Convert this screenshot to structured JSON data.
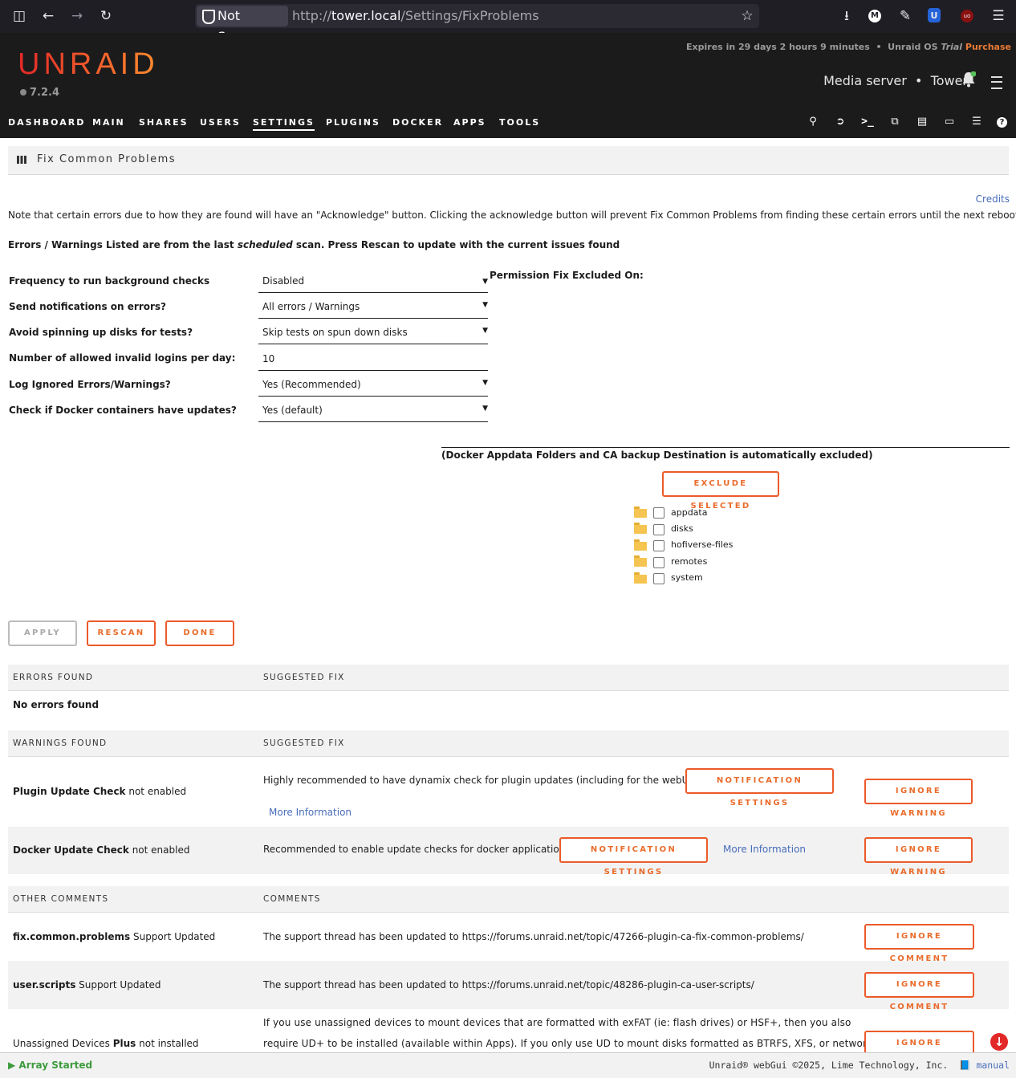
{
  "browser": {
    "not_secure": "Not Secure",
    "url_prefix": "http://",
    "url_host": "tower.local",
    "url_path": "/Settings/FixProblems"
  },
  "header": {
    "logo": "UNRAID",
    "version": "7.2.4",
    "trial_text": "Expires in 29 days 2 hours 9 minutes",
    "os_label": "Unraid OS",
    "os_trial": "Trial",
    "purchase": "Purchase",
    "server_desc": "Media server",
    "server_name": "Tower",
    "accent": "#f15a2c"
  },
  "nav": [
    "DASHBOARD",
    "MAIN",
    "SHARES",
    "USERS",
    "SETTINGS",
    "PLUGINS",
    "DOCKER",
    "APPS",
    "TOOLS"
  ],
  "page": {
    "title": "Fix Common Problems",
    "credits": "Credits",
    "note": "Note that certain errors due to how they are found will have an \"Acknowledge\" button. Clicking the acknowledge button will prevent Fix Common Problems from finding these certain errors until the next reboot",
    "scan_note_a": "Errors / Warnings Listed are from the last ",
    "scan_note_b": "scheduled",
    "scan_note_c": " scan. Press Rescan to update with the current issues found"
  },
  "settings": [
    {
      "label": "Frequency to run background checks",
      "value": "Disabled"
    },
    {
      "label": "Send notifications on errors?",
      "value": "All errors / Warnings"
    },
    {
      "label": "Avoid spinning up disks for tests?",
      "value": "Skip tests on spun down disks"
    },
    {
      "label": "Number of allowed invalid logins per day:",
      "value": "10"
    },
    {
      "label": "Log Ignored Errors/Warnings?",
      "value": "Yes (Recommended)"
    },
    {
      "label": "Check if Docker containers have updates?",
      "value": "Yes (default)"
    }
  ],
  "permission": {
    "title": "Permission Fix Excluded On:",
    "note": "(Docker Appdata Folders and CA backup Destination is automatically excluded)",
    "exclude_btn": "EXCLUDE SELECTED",
    "folders": [
      "appdata",
      "disks",
      "hofiverse-files",
      "remotes",
      "system"
    ]
  },
  "buttons": {
    "apply": "APPLY",
    "rescan": "RESCAN",
    "done": "DONE"
  },
  "errors": {
    "head1": "ERRORS FOUND",
    "head2": "SUGGESTED FIX",
    "none": "No errors found"
  },
  "warnings": {
    "head1": "WARNINGS FOUND",
    "head2": "SUGGESTED FIX",
    "items": [
      {
        "name_b": "Plugin Update Check",
        "name_r": " not enabled",
        "fix": "Highly recommended to have dynamix check for plugin updates (including for the webUI",
        "btn": "NOTIFICATION SETTINGS",
        "more": "More Information",
        "ignore": "IGNORE WARNING"
      },
      {
        "name_b": "Docker Update Check",
        "name_r": " not enabled",
        "fix": "Recommended to enable update checks for docker applications",
        "btn": "NOTIFICATION SETTINGS",
        "more": "More Information",
        "ignore": "IGNORE WARNING"
      }
    ]
  },
  "comments": {
    "head1": "OTHER COMMENTS",
    "head2": "COMMENTS",
    "items": [
      {
        "name_b": "fix.common.problems",
        "name_r": " Support Updated",
        "text": "The support thread has been updated to https://forums.unraid.net/topic/47266-plugin-ca-fix-common-problems/",
        "ignore": "IGNORE COMMENT"
      },
      {
        "name_b": "user.scripts",
        "name_r": " Support Updated",
        "text": "The support thread has been updated to https://forums.unraid.net/topic/48286-plugin-ca-user-scripts/",
        "ignore": "IGNORE COMMENT"
      },
      {
        "name_a": "Unassigned Devices ",
        "name_b": "Plus",
        "name_r": " not installed",
        "text1": "If you use unassigned devices to mount devices that are formatted with exFAT (ie: flash drives) or HSF+, then you also",
        "text2": "require UD+ to be installed (available within Apps). If you only use UD to mount disks formatted as BTRFS, XFS, or network",
        "ignore": "IGNORE COMMENT"
      }
    ]
  },
  "footer": {
    "status": "Array Started",
    "copyright": "Unraid® webGui ©2025, Lime Technology, Inc.",
    "manual": "manual"
  }
}
